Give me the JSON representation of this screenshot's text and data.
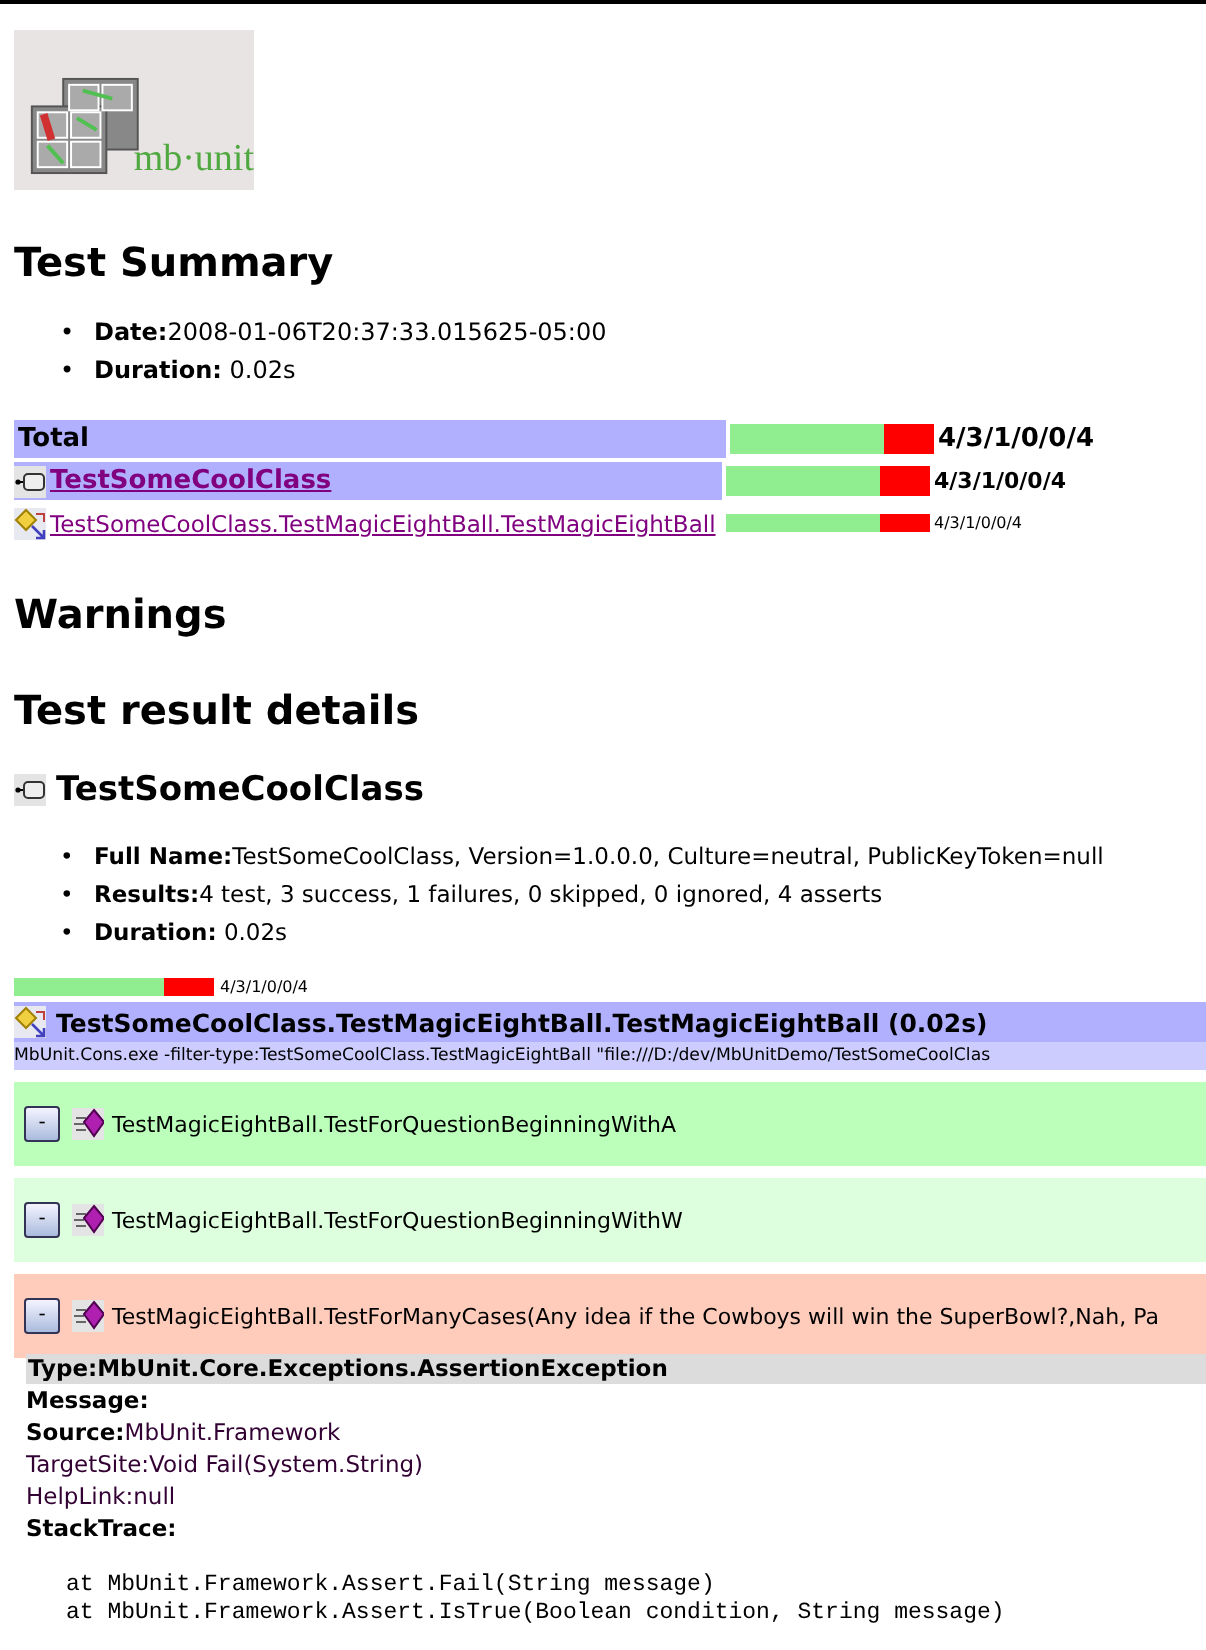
{
  "logo": {
    "text": "mb·unit"
  },
  "summary": {
    "title": "Test Summary",
    "facts": [
      {
        "bullet": "•",
        "text": "**Date:**2008-01-06T20:37:33.015625-05:00"
      },
      {
        "bullet": "•",
        "text": "**Duration:** 0.02s"
      }
    ],
    "rows": [
      {
        "kind": "total",
        "label": "Total",
        "level": 0.75,
        "counts": "4/3/1/0/0/4"
      },
      {
        "kind": "class",
        "label": "TestSomeCoolClass",
        "level": 0.75,
        "counts": "4/3/1/0/0/4"
      },
      {
        "kind": "fixture",
        "label": "TestSomeCoolClass.TestMagicEightBall.TestMagicEightBall",
        "level": 0.75,
        "counts": "4/3/1/0/0/4"
      }
    ]
  },
  "warnings": {
    "title": "Warnings"
  },
  "details": {
    "title": "Test result details",
    "class": {
      "name": "TestSomeCoolClass",
      "facts": [
        {
          "bullet": "•",
          "text": "**Full Name:**TestSomeCoolClass, Version=1.0.0.0, Culture=neutral, PublicKeyToken=null"
        },
        {
          "bullet": "•",
          "text": "**Results:**4 test, 3 success, 1 failures, 0 skipped, 0 ignored, 4 asserts"
        },
        {
          "bullet": "•",
          "text": "**Duration:** 0.02s"
        }
      ],
      "level": 0.75,
      "counts": "4/3/1/0/0/4"
    },
    "fixture": {
      "title": "TestSomeCoolClass.TestMagicEightBall.TestMagicEightBall (0.02s)",
      "command": "MbUnit.Cons.exe -filter-type:TestSomeCoolClass.TestMagicEightBall \"file:///D:/dev/MbUnitDemo/TestSomeCoolClas"
    },
    "tests": [
      {
        "toggle": "-",
        "name": "TestMagicEightBall.TestForQuestionBeginningWithA",
        "color": "#bbffbb"
      },
      {
        "toggle": "-",
        "name": "TestMagicEightBall.TestForQuestionBeginningWithW",
        "color": "#ddffdd"
      },
      {
        "toggle": "-",
        "name": "TestMagicEightBall.TestForManyCases(Any idea if the Cowboys will win the SuperBowl?,Nah, Pa",
        "color": "#ffccbb"
      }
    ],
    "exception": {
      "type": "Type:MbUnit.Core.Exceptions.AssertionException",
      "lines": [
        {
          "text": "Message:",
          "bold": true
        },
        {
          "text": "**Source:**MbUnit.Framework",
          "bold": false
        },
        {
          "text": "TargetSite:Void Fail(System.String)",
          "bold": false
        },
        {
          "text": "HelpLink:null",
          "bold": false
        },
        {
          "text": "StackTrace:",
          "bold": true
        }
      ],
      "stack": [
        "at MbUnit.Framework.Assert.Fail(String message)",
        "at MbUnit.Framework.Assert.IsTrue(Boolean condition, String message)"
      ]
    }
  }
}
